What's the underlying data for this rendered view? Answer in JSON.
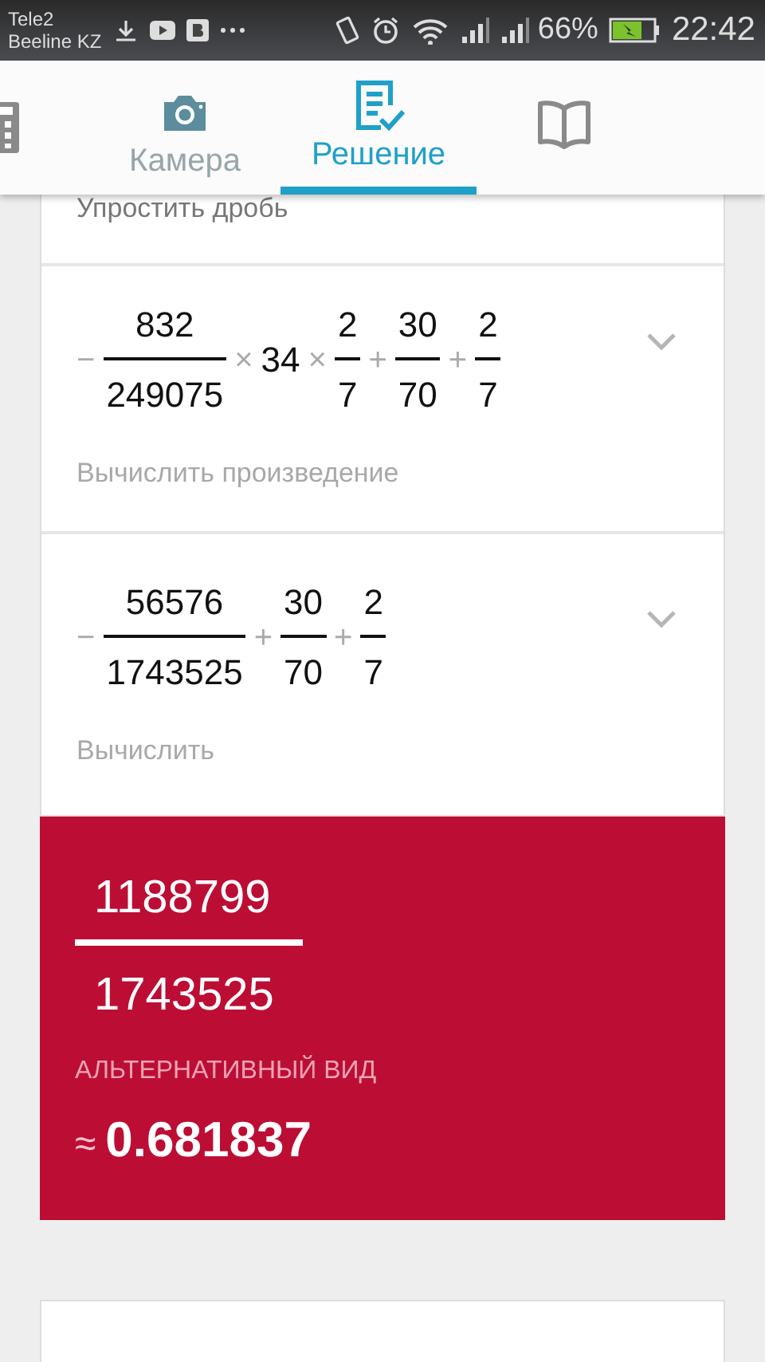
{
  "status_bar": {
    "carriers": [
      "Tele2",
      "Beeline KZ"
    ],
    "battery_text": "66%",
    "time": "22:42"
  },
  "tabs": [
    {
      "kind": "calculator",
      "selected": false
    },
    {
      "kind": "camera",
      "label": "Камера",
      "selected": false
    },
    {
      "kind": "solution",
      "label": "Решение",
      "selected": true
    },
    {
      "kind": "book",
      "selected": false
    }
  ],
  "steps": [
    {
      "caption": "Упростить дробь"
    },
    {
      "expression": [
        {
          "kind": "op",
          "text": "−"
        },
        {
          "kind": "fraction",
          "num": "832",
          "den": "249075"
        },
        {
          "kind": "op",
          "text": "×"
        },
        {
          "kind": "number",
          "text": "34"
        },
        {
          "kind": "op",
          "text": "×"
        },
        {
          "kind": "fraction",
          "num": "2",
          "den": "7"
        },
        {
          "kind": "op",
          "text": "+"
        },
        {
          "kind": "fraction",
          "num": "30",
          "den": "70"
        },
        {
          "kind": "op",
          "text": "+"
        },
        {
          "kind": "fraction",
          "num": "2",
          "den": "7"
        }
      ],
      "caption": "Вычислить произведение",
      "expanded": false
    },
    {
      "expression": [
        {
          "kind": "op",
          "text": "−"
        },
        {
          "kind": "fraction",
          "num": "56576",
          "den": "1743525"
        },
        {
          "kind": "op",
          "text": "+"
        },
        {
          "kind": "fraction",
          "num": "30",
          "den": "70"
        },
        {
          "kind": "op",
          "text": "+"
        },
        {
          "kind": "fraction",
          "num": "2",
          "den": "7"
        }
      ],
      "caption": "Вычислить",
      "expanded": false
    }
  ],
  "result": {
    "num": "1188799",
    "den": "1743525",
    "alt_label": "АЛЬТЕРНАТИВНЫЙ ВИД",
    "approx_sign": "≈",
    "approx_value": "0.681837"
  }
}
